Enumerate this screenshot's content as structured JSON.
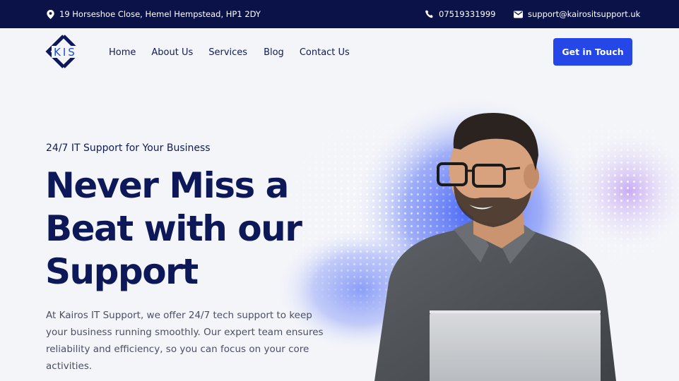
{
  "topbar": {
    "address": "19 Horseshoe Close, Hemel Hempstead, HP1 2DY",
    "phone": "07519331999",
    "email": "support@kairositsupport.uk",
    "icons": [
      "location-pin-icon",
      "phone-icon",
      "mail-icon"
    ]
  },
  "header": {
    "logo_text": "KIS",
    "nav": [
      "Home",
      "About Us",
      "Services",
      "Blog",
      "Contact Us"
    ],
    "cta_label": "Get in Touch"
  },
  "hero": {
    "eyebrow": "24/7 IT Support for Your Business",
    "headline": [
      "Never Miss a",
      "Beat with our",
      "Support"
    ],
    "body": "At Kairos IT Support, we offer 24/7 tech support to keep your business running smoothly. Our expert team ensures reliability and efficiency, so you can focus on your core activities."
  },
  "colors": {
    "topbar_bg": "#0b1247",
    "accent": "#2547e8",
    "heading": "#0d1858",
    "page_bg": "#f4f5f9"
  }
}
